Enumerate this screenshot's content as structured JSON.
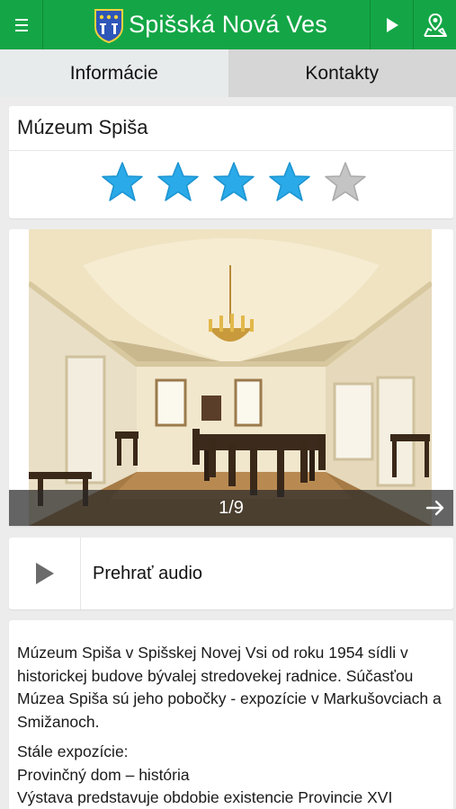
{
  "app_bar": {
    "title": "Spišská Nová Ves",
    "icons": {
      "menu": "hamburger-menu-icon",
      "coat_of_arms": "coat-of-arms-icon",
      "play": "play-icon",
      "map": "map-marker-icon"
    },
    "color": "#14a646"
  },
  "tabs": [
    {
      "label": "Informácie",
      "active": true
    },
    {
      "label": "Kontakty",
      "active": false
    }
  ],
  "place": {
    "name": "Múzeum Spiša",
    "rating": 4,
    "rating_max": 5,
    "star_color": "#2aaae8",
    "star_empty_color": "#c4c4c4"
  },
  "gallery": {
    "counter": "1/9",
    "next_icon": "arrow-right-icon"
  },
  "audio": {
    "label": "Prehrať audio",
    "icon": "play-icon"
  },
  "description": {
    "paragraph1": "Múzeum Spiša v Spišskej Novej Vsi od roku 1954 sídli v historickej budove bývalej stredovekej radnice. Súčasťou Múzea Spiša sú jeho pobočky - expozície v Markušovciach a Smižanoch.",
    "line1": "Stále expozície:",
    "line2": "Provinčný dom – história",
    "line3": "Výstava predstavuje obdobie existencie Provincie XVI"
  }
}
